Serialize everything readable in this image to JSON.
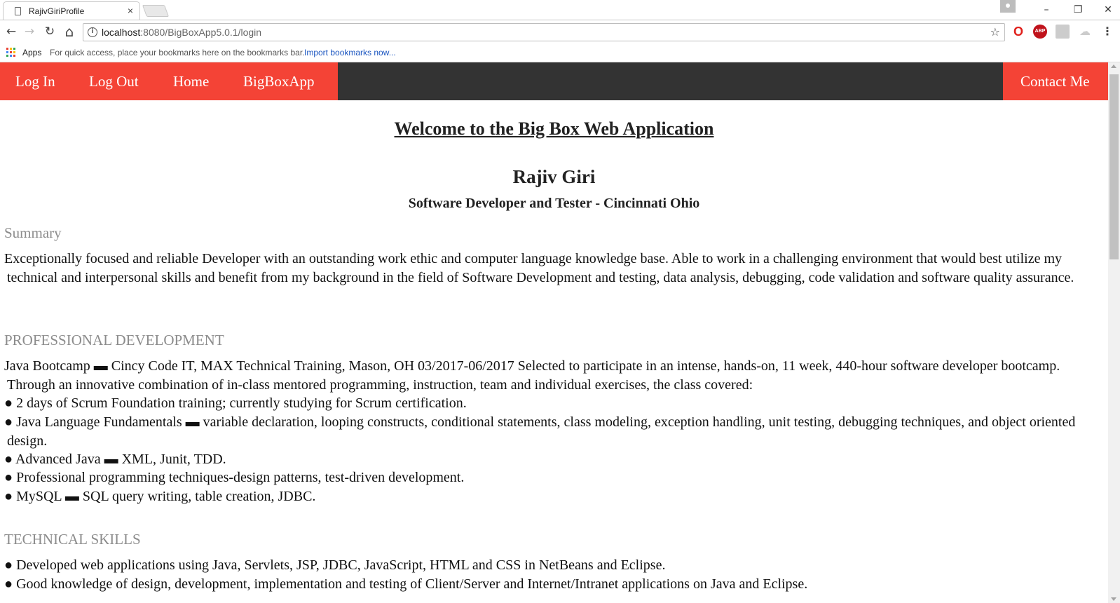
{
  "browser": {
    "tab_title": "RajivGiriProfile",
    "tab_close": "×",
    "url_host": "localhost",
    "url_rest": ":8080/BigBoxApp5.0.1/login",
    "bookmarks": {
      "apps_label": "Apps",
      "hint": "For quick access, place your bookmarks here on the bookmarks bar.",
      "import_link": "Import bookmarks now..."
    },
    "icons": {
      "back": "←",
      "forward": "→",
      "reload": "↻",
      "home": "⌂",
      "info": "i",
      "star": "☆",
      "opera": "O",
      "abp": "ABP",
      "cloud": "☁",
      "menu": "⋮",
      "minimize": "–",
      "restore": "❐",
      "close": "✕"
    },
    "apps_colors": [
      "#e94235",
      "#fbbc04",
      "#34a853",
      "#4285f4",
      "#e94235",
      "#fbbc04",
      "#34a853",
      "#4285f4",
      "#e94235"
    ]
  },
  "nav": {
    "login": "Log In",
    "logout": "Log Out",
    "home": "Home",
    "bigboxapp": "BigBoxApp",
    "contact": "Contact Me",
    "accent_color": "#f44336",
    "bar_color": "#333333"
  },
  "page": {
    "welcome": "Welcome to the Big Box Web Application",
    "name": "Rajiv Giri",
    "tagline": "Software Developer and Tester - Cincinnati Ohio",
    "summary": {
      "heading": "Summary",
      "text": "Exceptionally focused and reliable Developer with an outstanding work ethic and computer language knowledge base. Able to work in a challenging environment that would best utilize my technical and interpersonal skills and benefit from my background in the field of Software Development and testing, data analysis, debugging, code validation and software quality assurance."
    },
    "professional": {
      "heading": "PROFESSIONAL DEVELOPMENT",
      "intro": "Java Bootcamp ▬ Cincy Code IT, MAX Technical Training, Mason, OH 03/2017-06/2017 Selected to participate in an intense, hands-on, 11 week, 440-hour software developer bootcamp. Through an innovative combination of in-class mentored programming, instruction, team and individual exercises, the class covered:",
      "bullets": [
        "● 2 days of Scrum Foundation training; currently studying for Scrum certification.",
        "● Java Language Fundamentals ▬ variable declaration, looping constructs, conditional statements, class modeling, exception handling, unit testing, debugging techniques, and object oriented design.",
        "● Advanced Java ▬ XML, Junit, TDD.",
        "● Professional programming techniques-design patterns, test-driven development.",
        "● MySQL ▬ SQL query writing, table creation, JDBC."
      ]
    },
    "technical": {
      "heading": "TECHNICAL SKILLS",
      "bullets": [
        "● Developed web applications using Java, Servlets, JSP, JDBC, JavaScript, HTML and CSS in NetBeans and Eclipse.",
        "● Good knowledge of design, development, implementation and testing of Client/Server and Internet/Intranet applications on Java and Eclipse."
      ]
    }
  }
}
